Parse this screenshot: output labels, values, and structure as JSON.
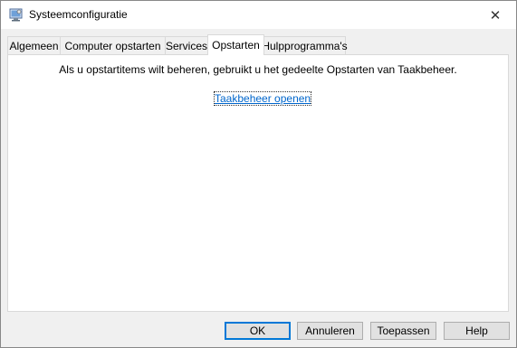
{
  "window": {
    "title": "Systeemconfiguratie",
    "icon": "msconfig-icon",
    "close_glyph": "✕"
  },
  "tabs": [
    {
      "label": "Algemeen",
      "active": false
    },
    {
      "label": "Computer opstarten",
      "active": false
    },
    {
      "label": "Services",
      "active": false
    },
    {
      "label": "Opstarten",
      "active": true
    },
    {
      "label": "Hulpprogramma's",
      "active": false
    }
  ],
  "panel": {
    "message": "Als u opstartitems wilt beheren, gebruikt u het gedeelte Opstarten van Taakbeheer.",
    "link_label": "Taakbeheer openen"
  },
  "buttons": {
    "ok": "OK",
    "cancel": "Annuleren",
    "apply": "Toepassen",
    "help": "Help"
  },
  "colors": {
    "accent": "#0078d7",
    "link": "#0066cc"
  }
}
